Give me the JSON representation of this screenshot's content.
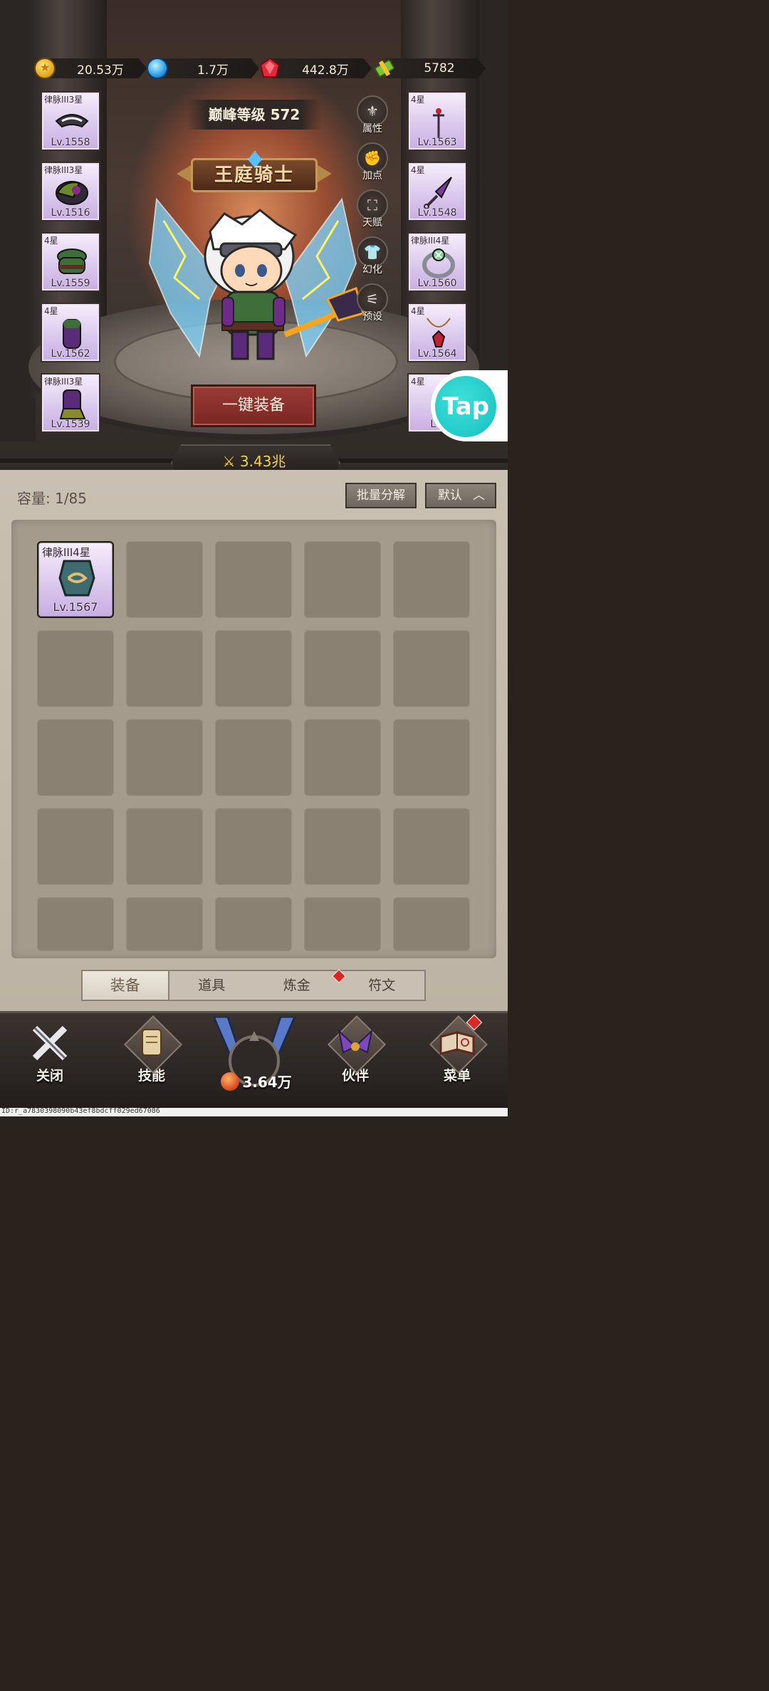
{
  "currency": [
    {
      "icon": "gold-coin-icon",
      "value": "20.53万"
    },
    {
      "icon": "blue-orb-icon",
      "value": "1.7万"
    },
    {
      "icon": "red-gem-icon",
      "value": "442.8万"
    },
    {
      "icon": "cash-bundle-icon",
      "value": "5782"
    }
  ],
  "hero": {
    "peak_level": "巅峰等级 572",
    "class_title": "王庭骑士"
  },
  "left_slots": [
    {
      "tag": "律脉III3星",
      "level": "Lv.1558"
    },
    {
      "tag": "律脉III3星",
      "level": "Lv.1516"
    },
    {
      "tag": "4星",
      "level": "Lv.1559"
    },
    {
      "tag": "4星",
      "level": "Lv.1562"
    },
    {
      "tag": "律脉III3星",
      "level": "Lv.1539"
    }
  ],
  "right_slots": [
    {
      "tag": "4星",
      "level": "Lv.1563"
    },
    {
      "tag": "4星",
      "level": "Lv.1548"
    },
    {
      "tag": "律脉III4星",
      "level": "Lv.1560"
    },
    {
      "tag": "4星",
      "level": "Lv.1564"
    },
    {
      "tag": "4星",
      "level": "Lv."
    }
  ],
  "side_buttons": [
    {
      "label": "属性",
      "icon": "attribute-icon"
    },
    {
      "label": "加点",
      "icon": "fist-icon"
    },
    {
      "label": "天赋",
      "icon": "talent-tree-icon"
    },
    {
      "label": "幻化",
      "icon": "shirt-icon"
    },
    {
      "label": "预设",
      "icon": "sliders-icon"
    }
  ],
  "equip_all_label": "一键装备",
  "combat_power": "3.43兆",
  "tap_badge": "Tap",
  "inventory": {
    "capacity": "容量: 1/85",
    "batch_label": "批量分解",
    "sort_label": "默认",
    "items": [
      {
        "tag": "律脉III4星",
        "level": "Lv.1567"
      }
    ]
  },
  "tabs": [
    "装备",
    "道具",
    "炼金",
    "符文"
  ],
  "nav": [
    {
      "label": "关闭",
      "icon": "close-icon"
    },
    {
      "label": "技能",
      "icon": "skill-scroll-icon"
    },
    {
      "label": "伙伴",
      "icon": "partner-wings-icon"
    },
    {
      "label": "菜单",
      "icon": "menu-book-icon"
    }
  ],
  "center_value": "3.64万",
  "footer_id": "ID:r_a7830398090b43ef8bdcff029ed67086",
  "colors": {
    "accent_gold": "#f6d24a",
    "equip_red": "#9b3a35",
    "slot_purple": "#d9c6ec",
    "tap_teal": "#14c0c2"
  }
}
